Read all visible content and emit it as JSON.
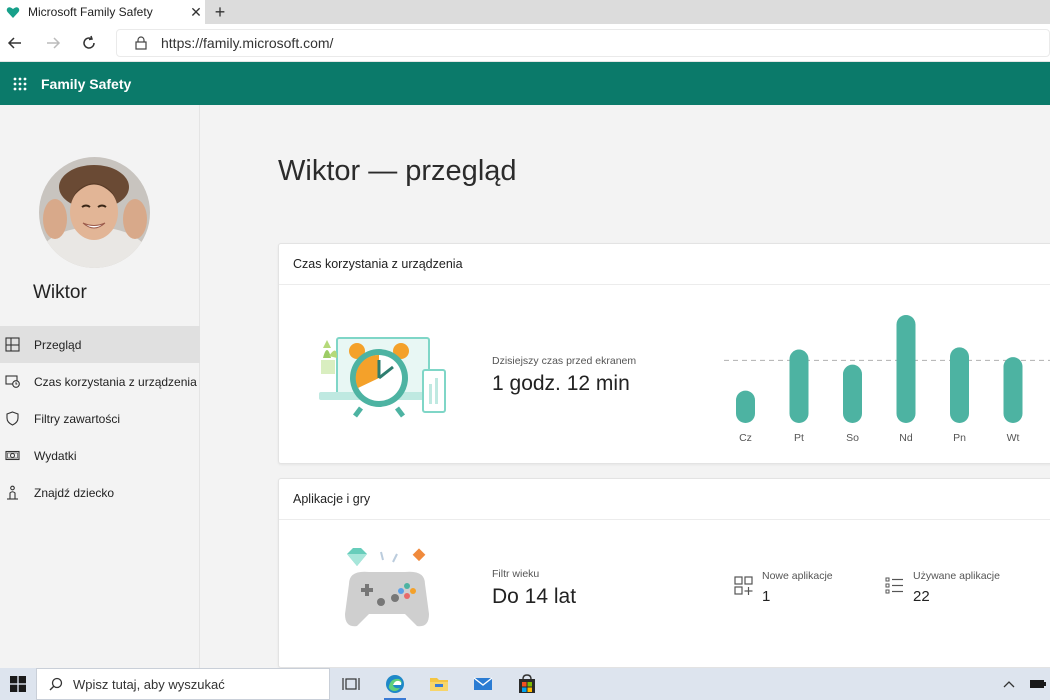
{
  "browser": {
    "tab_title": "Microsoft Family Safety",
    "url": "https://family.microsoft.com/"
  },
  "app": {
    "title": "Family Safety"
  },
  "sidebar": {
    "name": "Wiktor",
    "items": [
      {
        "label": "Przegląd",
        "icon": "overview-icon",
        "active": true
      },
      {
        "label": "Czas korzystania z urządzenia",
        "icon": "screen-time-icon"
      },
      {
        "label": "Filtry zawartości",
        "icon": "shield-icon"
      },
      {
        "label": "Wydatki",
        "icon": "money-icon"
      },
      {
        "label": "Znajdź dziecko",
        "icon": "person-location-icon"
      }
    ]
  },
  "main": {
    "title": "Wiktor — przegląd",
    "screen_time": {
      "header": "Czas korzystania z urządzenia",
      "today_label": "Dzisiejszy czas przed ekranem",
      "today_value": "1 godz. 12 min"
    },
    "apps": {
      "header": "Aplikacje i gry",
      "age_filter_label": "Filtr wieku",
      "age_filter_value": "Do 14 lat",
      "new_apps_label": "Nowe aplikacje",
      "new_apps_value": "1",
      "used_apps_label": "Używane aplikacje",
      "used_apps_value": "22"
    }
  },
  "chart_data": {
    "type": "bar",
    "categories": [
      "Cz",
      "Pt",
      "So",
      "Nd",
      "Pn",
      "Wt"
    ],
    "values": [
      0.3,
      0.68,
      0.54,
      1.0,
      0.7,
      0.61
    ],
    "average_line": 0.58,
    "color": "#4db3a2"
  },
  "taskbar": {
    "search_placeholder": "Wpisz tutaj, aby wyszukać"
  },
  "colors": {
    "brand": "#0b7a6a",
    "accent_teal": "#4db3a2"
  }
}
